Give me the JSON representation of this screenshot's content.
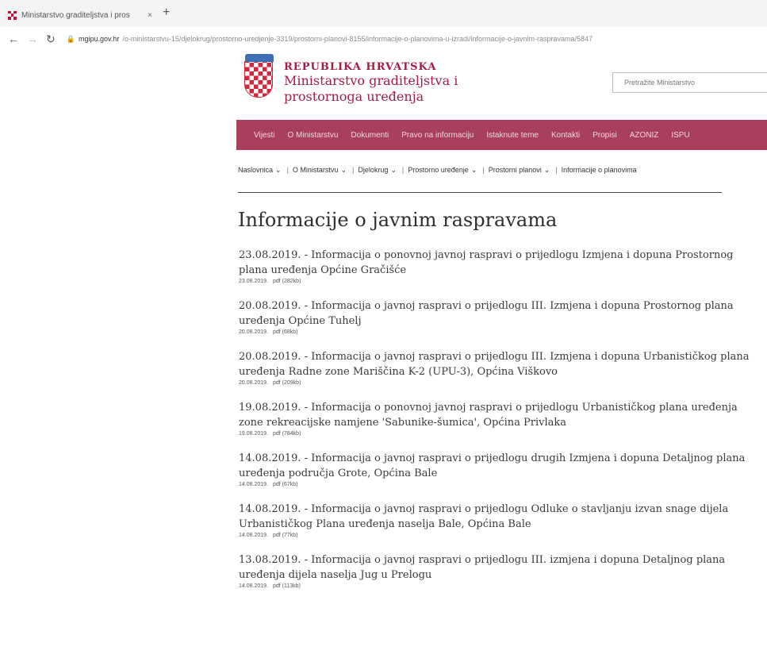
{
  "browser": {
    "tab_title": "Ministarstvo graditeljstva i pros",
    "tab_close": "×",
    "new_tab": "+",
    "url_host": "mgipu.gov.hr",
    "url_path": "/o-ministarstvu-15/djelokrug/prostorno-uredjenje-3319/prostorni-planovi-8155/informacije-o-planovima-u-izradi/informacije-o-javnim-raspravama/5847"
  },
  "header": {
    "logo_line1": "REPUBLIKA HRVATSKA",
    "logo_line2": "Ministarstvo graditeljstva i",
    "logo_line3": "prostornoga uređenja",
    "search_placeholder": "Pretražite Ministarstvo"
  },
  "mainnav": [
    "Vijesti",
    "O Ministarstvu",
    "Dokumenti",
    "Pravo na informaciju",
    "Istaknute teme",
    "Kontakti",
    "Propisi",
    "AZONIZ",
    "ISPU"
  ],
  "breadcrumb": [
    "Naslovnica",
    "O Ministarstvu",
    "Djelokrug",
    "Prostorno uređenje",
    "Prostorni planovi",
    "Informacije o planovima"
  ],
  "page_title": "Informacije o javnim raspravama",
  "items": [
    {
      "title": "23.08.2019. - Informacija o ponovnoj javnoj raspravi o prijedlogu Izmjena i dopuna Prostornog plana uređenja Općine Gračišće",
      "date": "23.08.2019.",
      "file": "pdf (282kb)"
    },
    {
      "title": "20.08.2019. - Informacija o javnoj raspravi o prijedlogu III. Izmjena i dopuna Prostornog plana uređenja Općine Tuhelj",
      "date": "20.08.2019.",
      "file": "pdf (68kb)"
    },
    {
      "title": "20.08.2019. - Informacija o javnoj raspravi o prijedlogu III. Izmjena i dopuna Urbanističkog plana uređenja Radne zone Mariščina K-2 (UPU-3), Općina Viškovo",
      "date": "20.08.2019.",
      "file": "pdf (209kb)"
    },
    {
      "title": "19.08.2019. - Informacija o ponovnoj javnoj raspravi o prijedlogu Urbanističkog plana uređenja zone rekreacijske namjene 'Sabunike-šumica', Općina Privlaka",
      "date": "19.08.2019.",
      "file": "pdf (784kb)"
    },
    {
      "title": "14.08.2019. - Informacija o javnoj raspravi o prijedlogu drugih Izmjena i dopuna Detaljnog plana uređenja područja Grote, Općina Bale",
      "date": "14.08.2019.",
      "file": "pdf (67kb)"
    },
    {
      "title": "14.08.2019. - Informacija o javnoj raspravi o prijedlogu Odluke o stavljanju izvan snage dijela Urbanističkog Plana uređenja naselja Bale, Općina Bale",
      "date": "14.08.2019.",
      "file": "pdf (77kb)"
    },
    {
      "title": "13.08.2019. - Informacija o javnoj raspravi o prijedlogu III. izmjena i dopuna Detaljnog plana uređenja dijela naselja Jug u Prelogu",
      "date": "14.08.2019.",
      "file": "pdf (113kb)"
    }
  ]
}
